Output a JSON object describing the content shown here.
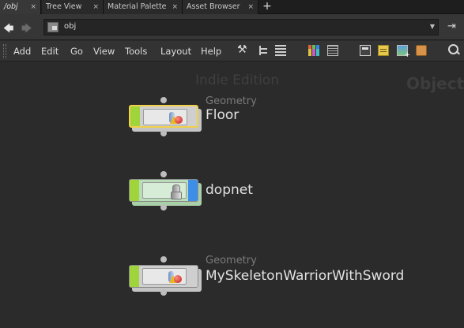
{
  "tabs": [
    {
      "label": "/obj",
      "active": true
    },
    {
      "label": "Tree View",
      "active": false
    },
    {
      "label": "Material Palette",
      "active": false
    },
    {
      "label": "Asset Browser",
      "active": false
    }
  ],
  "tab_close_glyph": "×",
  "add_tab_glyph": "+",
  "path": {
    "value": "obj"
  },
  "menu": [
    "Add",
    "Edit",
    "Go",
    "View",
    "Tools",
    "Layout",
    "Help"
  ],
  "canvas": {
    "watermark": "Indie Edition",
    "context": "Objects"
  },
  "nodes": [
    {
      "type": "Geometry",
      "name": "Floor",
      "selected": true,
      "flag_color": "#9fd43a",
      "display_flag_color": "#cfcfcf"
    },
    {
      "type": "",
      "name": "dopnet",
      "selected": false,
      "flag_color": "#9fd43a",
      "display_flag_color": "#3e8ee8"
    },
    {
      "type": "Geometry",
      "name": "MySkeletonWarriorWithSword",
      "selected": false,
      "flag_color": "#9fd43a",
      "display_flag_color": "#cfcfcf"
    }
  ],
  "colors": {
    "selection": "#f0d04a",
    "display_flag": "#3e8ee8",
    "bypass_flag": "#9fd43a"
  }
}
